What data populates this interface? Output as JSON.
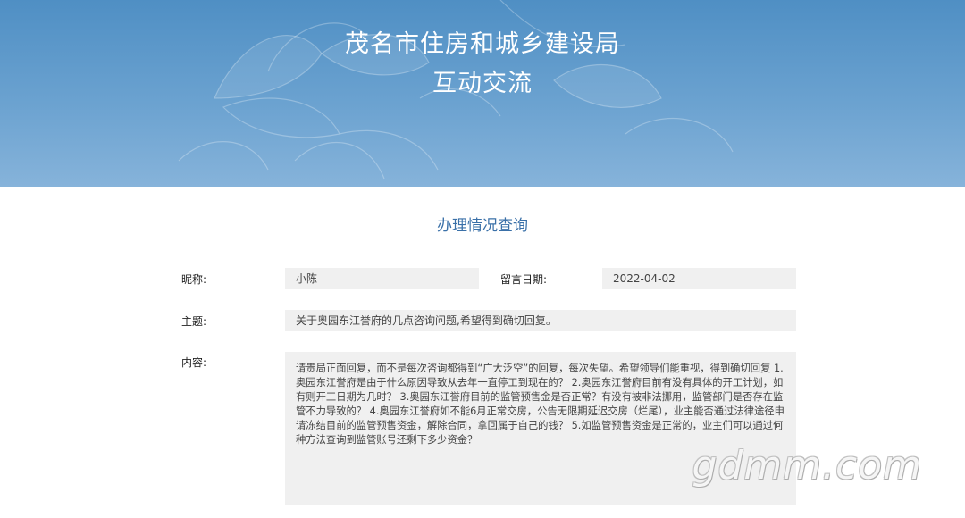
{
  "banner": {
    "title_line1": "茂名市住房和城乡建设局",
    "title_line2": "互动交流",
    "background_color": "#5b97c9"
  },
  "section": {
    "heading": "办理情况查询",
    "heading_color": "#3a70a8"
  },
  "form": {
    "nickname_label": "昵称:",
    "nickname_value": "小陈",
    "date_label": "留言日期:",
    "date_value": "2022-04-02",
    "subject_label": "主题:",
    "subject_value": "关于奥园东江誉府的几点咨询问题,希望得到确切回复。",
    "content_label": "内容:",
    "content_value": "请贵局正面回复，而不是每次咨询都得到“广大泛空”的回复，每次失望。希望领导们能重视，得到确切回复 1.奥园东江誉府是由于什么原因导致从去年一直停工到现在的？ 2.奥园东江誉府目前有没有具体的开工计划，如有则开工日期为几时？ 3.奥园东江誉府目前的监管预售金是否正常？有没有被非法挪用，监管部门是否存在监管不力导致的？ 4.奥园东江誉府如不能6月正常交房，公告无限期延迟交房（烂尾），业主能否通过法律途径申请冻结目前的监管预售资金，解除合同，拿回属于自己的钱？ 5.如监管预售资金是正常的，业主们可以通过何种方法查询到监管账号还剩下多少资金？",
    "field_background": "#f0f0f0"
  },
  "watermark": {
    "text": "gdmm.com"
  }
}
